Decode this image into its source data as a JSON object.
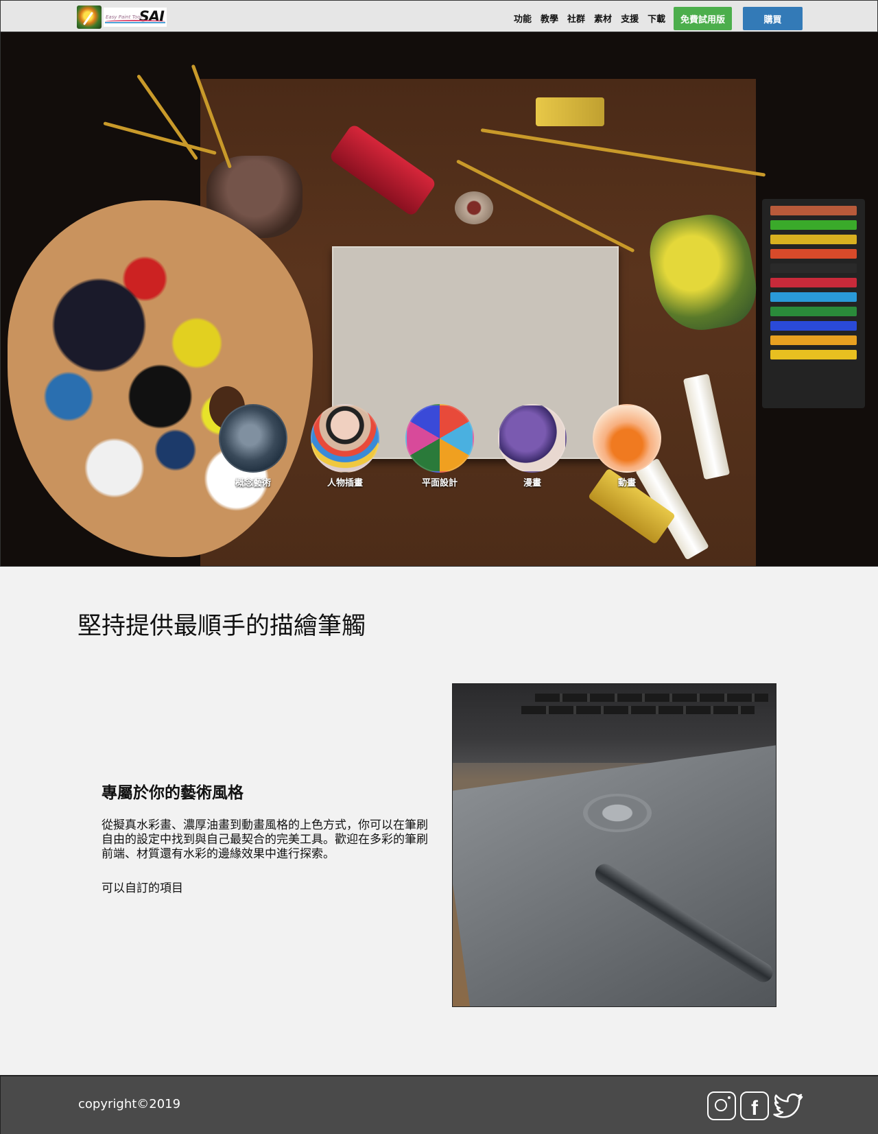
{
  "header": {
    "logo_small": "Easy Paint Tool",
    "logo_big": "SAI",
    "nav": [
      "功能",
      "教學",
      "社群",
      "素材",
      "支援",
      "下載"
    ],
    "trial_button": "免費試用版",
    "buy_button": "購買"
  },
  "hero": {
    "categories": [
      {
        "label": "概念藝術"
      },
      {
        "label": "人物插畫"
      },
      {
        "label": "平面設計"
      },
      {
        "label": "漫畫"
      },
      {
        "label": "動畫"
      }
    ]
  },
  "intro": {
    "title": "堅持提供最順手的描繪筆觸",
    "feature_title": "專屬於你的藝術風格",
    "feature_desc": "從擬真水彩畫、濃厚油畫到動畫風格的上色方式，你可以在筆刷自由的設定中找到與自己最契合的完美工具。歡迎在多彩的筆刷前端、材質還有水彩的邊緣效果中進行探索。",
    "feature_link": "可以自訂的項目"
  },
  "footer": {
    "copyright": "copyright©2019",
    "social": [
      "instagram-icon",
      "facebook-icon",
      "twitter-icon"
    ]
  },
  "colors": {
    "trial": "#4cae4c",
    "buy": "#337ab7",
    "footer": "#4a4a4a"
  }
}
